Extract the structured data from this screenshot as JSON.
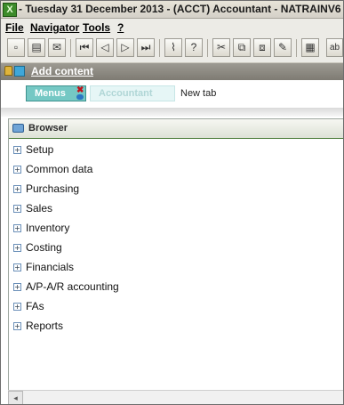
{
  "window": {
    "title": "- Tuesday 31 December 2013 - (ACCT) Accountant - NATRAINV6",
    "app_icon": "x3-logo-icon",
    "app_icon_text": "X"
  },
  "menubar": {
    "items": [
      "File",
      "Navigator",
      "Tools",
      "?"
    ]
  },
  "toolbar": {
    "buttons": [
      {
        "name": "new-icon",
        "glyph": "▫"
      },
      {
        "name": "print-icon",
        "glyph": "▤"
      },
      {
        "name": "mail-icon",
        "glyph": "✉"
      },
      {
        "name": "first-record-icon",
        "glyph": "⏮"
      },
      {
        "name": "previous-record-icon",
        "glyph": "◁"
      },
      {
        "name": "next-record-icon",
        "glyph": "▷"
      },
      {
        "name": "last-record-icon",
        "glyph": "⏭"
      },
      {
        "name": "attachment-icon",
        "glyph": "⌇"
      },
      {
        "name": "help-icon",
        "glyph": "?"
      },
      {
        "name": "cut-icon",
        "glyph": "✂"
      },
      {
        "name": "copy-icon",
        "glyph": "⧉"
      },
      {
        "name": "paste-icon",
        "glyph": "⧈"
      },
      {
        "name": "edit-icon",
        "glyph": "✎"
      },
      {
        "name": "calculator-icon",
        "glyph": "▦"
      },
      {
        "name": "spellcheck-icon",
        "glyph": "ab"
      }
    ]
  },
  "addbar": {
    "label": "Add content"
  },
  "tabs": {
    "menus": "Menus",
    "close_glyph": "✖",
    "accountant": "Accountant",
    "new_tab": "New tab"
  },
  "browser": {
    "title": "Browser",
    "expander_glyph": "+",
    "items": [
      "Setup",
      "Common data",
      "Purchasing",
      "Sales",
      "Inventory",
      "Costing",
      "Financials",
      "A/P-A/R accounting",
      "FAs",
      "Reports"
    ]
  },
  "scrollbar": {
    "left_glyph": "◂"
  }
}
